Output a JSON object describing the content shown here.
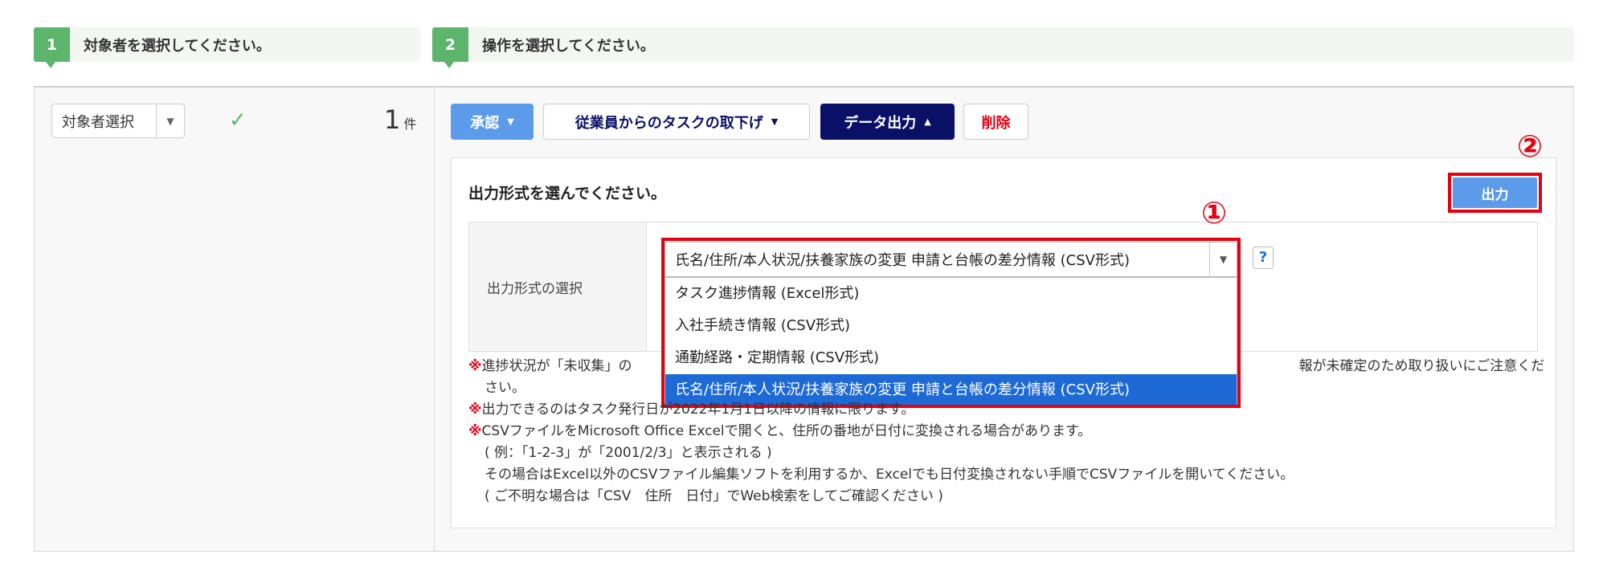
{
  "steps": [
    {
      "num": "1",
      "text": "対象者を選択してください。"
    },
    {
      "num": "2",
      "text": "操作を選択してください。"
    }
  ],
  "left": {
    "select_label": "対象者選択",
    "count": "1",
    "count_unit": "件"
  },
  "actions": {
    "approve": "承認",
    "withdraw": "従業員からのタスクの取下げ",
    "data_output": "データ出力",
    "delete": "削除"
  },
  "output": {
    "heading": "出力形式を選んでください。",
    "button": "出力",
    "row_label": "出力形式の選択",
    "selected": "氏名/住所/本人状況/扶養家族の変更 申請と台帳の差分情報 (CSV形式)",
    "help": "?",
    "options": [
      "タスク進捗情報 (Excel形式)",
      "入社手続き情報 (CSV形式)",
      "通勤経路・定期情報 (CSV形式)",
      "氏名/住所/本人状況/扶養家族の変更 申請と台帳の差分情報 (CSV形式)"
    ]
  },
  "annotations": {
    "one": "①",
    "two": "②"
  },
  "notes": {
    "mark": "※",
    "n1a": "進捗状況が「未収集」の",
    "n1b": "報が未確定のため取り扱いにご注意ください。",
    "n2": "出力できるのはタスク発行日が2022年1月1日以降の情報に限ります。",
    "n3": "CSVファイルをMicrosoft Office Excelで開くと、住所の番地が日付に変換される場合があります。",
    "n3b": "( 例：「1-2-3」が「2001/2/3」と表示される )",
    "n3c": "その場合はExcel以外のCSVファイル編集ソフトを利用するか、Excelでも日付変換されない手順でCSVファイルを開いてください。",
    "n3d": "( ご不明な場合は「CSV　住所　日付」でWeb検索をしてご確認ください )"
  },
  "colors": {
    "accent_green": "#5cb56a",
    "primary_blue": "#5b9bea",
    "navy": "#0a1066",
    "highlight": "#e60012"
  }
}
